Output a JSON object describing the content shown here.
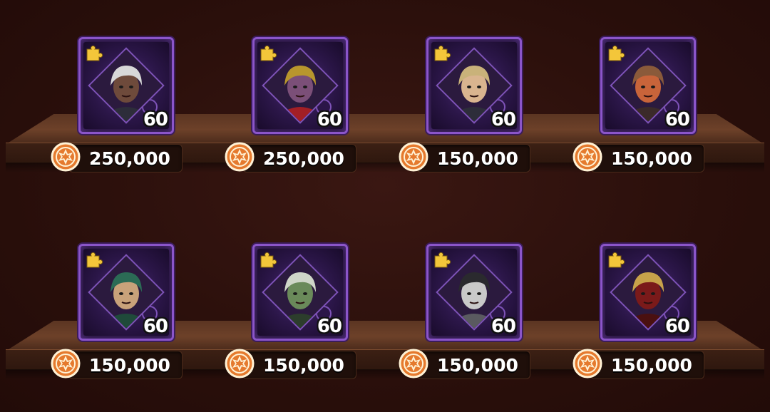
{
  "shop": {
    "items": [
      {
        "level": "60",
        "price": "250,000",
        "portrait_icon": "hooded-elf-assassin-portrait-icon",
        "skin": "#6e4a3b",
        "hair": "#d8d8d8",
        "accent": "#2d2d3a"
      },
      {
        "level": "60",
        "price": "250,000",
        "portrait_icon": "dark-armored-knight-portrait-icon",
        "skin": "#7b4f78",
        "hair": "#b8962d",
        "accent": "#a31f25"
      },
      {
        "level": "60",
        "price": "150,000",
        "portrait_icon": "blonde-rogue-portrait-icon",
        "skin": "#d9b48f",
        "hair": "#c9b27a",
        "accent": "#2d2d3a"
      },
      {
        "level": "60",
        "price": "150,000",
        "portrait_icon": "horned-beast-warrior-portrait-icon",
        "skin": "#c8643a",
        "hair": "#8a5a3a",
        "accent": "#3b2a2a"
      },
      {
        "level": "60",
        "price": "150,000",
        "portrait_icon": "minotaur-druid-portrait-icon",
        "skin": "#c9a27a",
        "hair": "#2b6b55",
        "accent": "#1f4a3a"
      },
      {
        "level": "60",
        "price": "150,000",
        "portrait_icon": "green-orc-shaman-portrait-icon",
        "skin": "#6a8a5a",
        "hair": "#cfd6c8",
        "accent": "#2c3d2c"
      },
      {
        "level": "60",
        "price": "150,000",
        "portrait_icon": "plague-doctor-portrait-icon",
        "skin": "#c9c9c9",
        "hair": "#2a2a2e",
        "accent": "#5a5a60"
      },
      {
        "level": "60",
        "price": "150,000",
        "portrait_icon": "golden-helmed-warrior-portrait-icon",
        "skin": "#7a1a1a",
        "hair": "#c7a24a",
        "accent": "#4a1010"
      }
    ]
  },
  "colors": {
    "card_border": "#8b55c9",
    "puzzle_icon": "#f3c63a",
    "coin": "#e57a2e"
  },
  "icons": {
    "puzzle": "puzzle-piece-icon",
    "coin": "gold-coin-icon"
  }
}
